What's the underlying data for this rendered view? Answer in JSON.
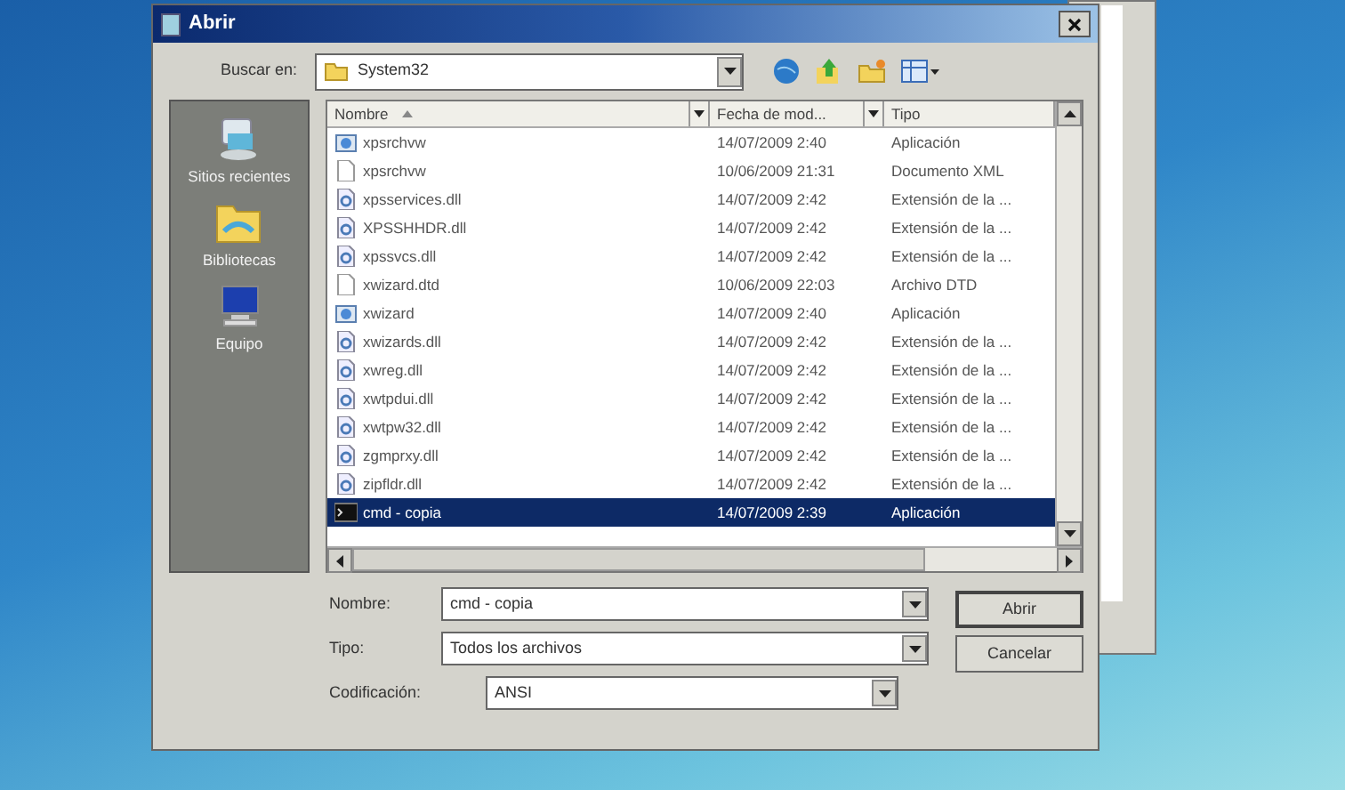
{
  "window": {
    "title": "Abrir"
  },
  "look_in": {
    "label": "Buscar en:",
    "value": "System32"
  },
  "places": [
    {
      "label": "Sitios recientes",
      "kind": "recent"
    },
    {
      "label": "Bibliotecas",
      "kind": "libraries"
    },
    {
      "label": "Equipo",
      "kind": "computer"
    }
  ],
  "table": {
    "columns": [
      "Nombre",
      "Fecha de mod...",
      "Tipo"
    ],
    "rows": [
      {
        "kind": "app",
        "name": "xpsrchvw",
        "date": "14/07/2009 2:40",
        "type": "Aplicación",
        "selected": false
      },
      {
        "kind": "doc",
        "name": "xpsrchvw",
        "date": "10/06/2009 21:31",
        "type": "Documento XML",
        "selected": false
      },
      {
        "kind": "dll",
        "name": "xpsservices.dll",
        "date": "14/07/2009 2:42",
        "type": "Extensión de la ...",
        "selected": false
      },
      {
        "kind": "dll",
        "name": "XPSSHHDR.dll",
        "date": "14/07/2009 2:42",
        "type": "Extensión de la ...",
        "selected": false
      },
      {
        "kind": "dll",
        "name": "xpssvcs.dll",
        "date": "14/07/2009 2:42",
        "type": "Extensión de la ...",
        "selected": false
      },
      {
        "kind": "doc",
        "name": "xwizard.dtd",
        "date": "10/06/2009 22:03",
        "type": "Archivo DTD",
        "selected": false
      },
      {
        "kind": "app",
        "name": "xwizard",
        "date": "14/07/2009 2:40",
        "type": "Aplicación",
        "selected": false
      },
      {
        "kind": "dll",
        "name": "xwizards.dll",
        "date": "14/07/2009 2:42",
        "type": "Extensión de la ...",
        "selected": false
      },
      {
        "kind": "dll",
        "name": "xwreg.dll",
        "date": "14/07/2009 2:42",
        "type": "Extensión de la ...",
        "selected": false
      },
      {
        "kind": "dll",
        "name": "xwtpdui.dll",
        "date": "14/07/2009 2:42",
        "type": "Extensión de la ...",
        "selected": false
      },
      {
        "kind": "dll",
        "name": "xwtpw32.dll",
        "date": "14/07/2009 2:42",
        "type": "Extensión de la ...",
        "selected": false
      },
      {
        "kind": "dll",
        "name": "zgmprxy.dll",
        "date": "14/07/2009 2:42",
        "type": "Extensión de la ...",
        "selected": false
      },
      {
        "kind": "dll",
        "name": "zipfldr.dll",
        "date": "14/07/2009 2:42",
        "type": "Extensión de la ...",
        "selected": false
      },
      {
        "kind": "console",
        "name": "cmd - copia",
        "date": "14/07/2009 2:39",
        "type": "Aplicación",
        "selected": true
      }
    ]
  },
  "fields": [
    {
      "label": "Nombre:",
      "value": "cmd - copia"
    },
    {
      "label": "Tipo:",
      "value": "Todos los archivos"
    },
    {
      "label": "Codificación:",
      "value": "ANSI"
    }
  ],
  "buttons": [
    "Abrir",
    "Cancelar"
  ]
}
